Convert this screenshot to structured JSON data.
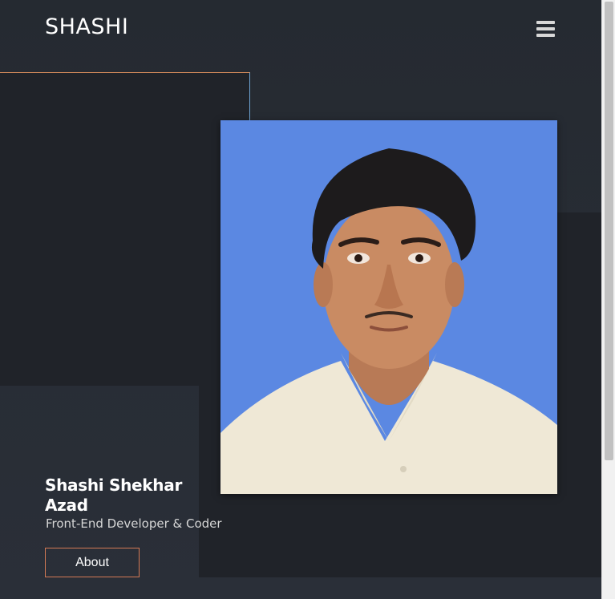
{
  "header": {
    "brand": "SHASHI",
    "menu_icon": "hamburger-menu-icon"
  },
  "hero": {
    "photo_alt": "",
    "name": "Shashi Shekhar Azad",
    "role": "Front-End Developer & Coder",
    "about_label": "About"
  },
  "colors": {
    "background": "#272c34",
    "panel": "#202329",
    "accent_border": "#d47a55",
    "photo_background": "#5b88e2"
  }
}
